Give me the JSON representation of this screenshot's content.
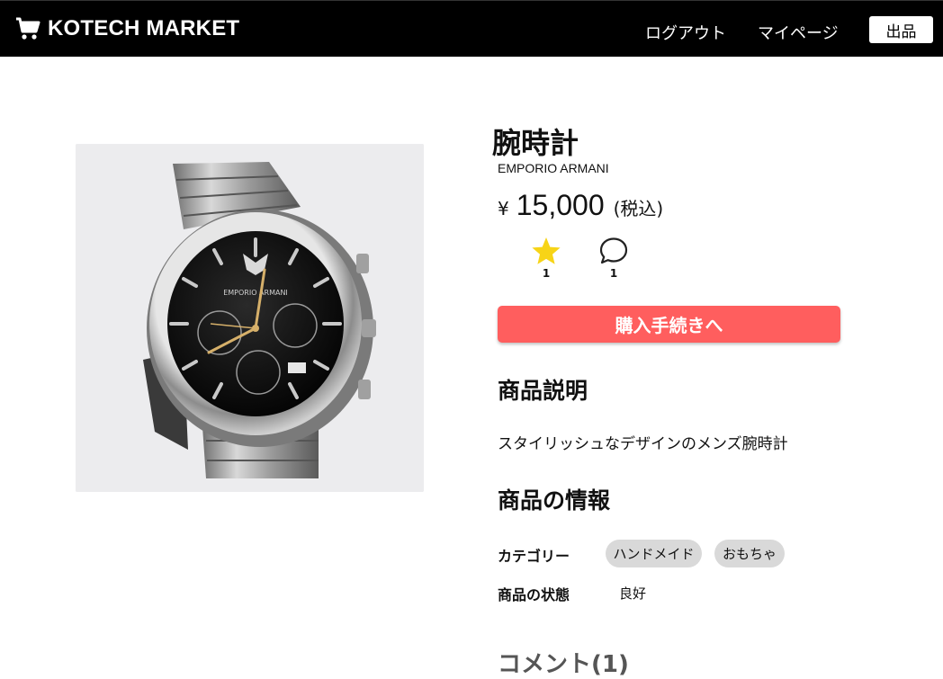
{
  "header": {
    "brand": "KOTECH MARKET",
    "logout_label": "ログアウト",
    "mypage_label": "マイページ",
    "sell_label": "出品"
  },
  "product": {
    "title": "腕時計",
    "brand": "EMPORIO ARMANI",
    "currency": "¥",
    "price": "15,000",
    "tax_note": "(税込)",
    "likes": "1",
    "comments": "1",
    "buy_label": "購入手続きへ",
    "image_icon": "wristwatch-image",
    "dial_brand": "EMPORIO ARMANI"
  },
  "description": {
    "heading": "商品説明",
    "text": "スタイリッシュなデザインのメンズ腕時計"
  },
  "info": {
    "heading": "商品の情報",
    "category_label": "カテゴリー",
    "categories": [
      "ハンドメイド",
      "おもちゃ"
    ],
    "condition_label": "商品の状態",
    "condition_value": "良好"
  },
  "comments": {
    "heading": "コメント(1)"
  },
  "colors": {
    "header_bg": "#000000",
    "buy_button": "#ff5e5e",
    "star": "#f7d417",
    "tag_bg": "#d9d9d9"
  }
}
